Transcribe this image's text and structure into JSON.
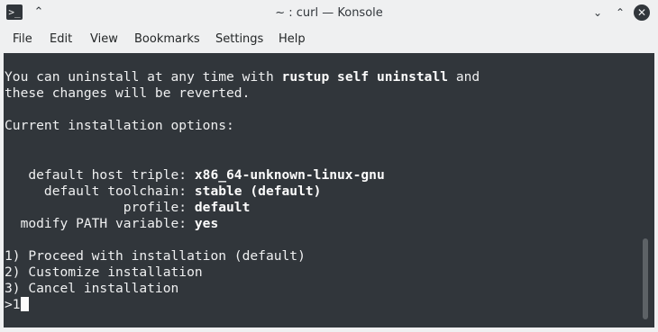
{
  "window": {
    "title": "~ : curl — Konsole"
  },
  "menu": [
    "File",
    "Edit",
    "View",
    "Bookmarks",
    "Settings",
    "Help"
  ],
  "terminal": {
    "lines": [
      {
        "segments": [
          {
            "t": "You can uninstall at any time with "
          },
          {
            "t": "rustup self uninstall",
            "b": true
          },
          {
            "t": " and"
          }
        ]
      },
      {
        "segments": [
          {
            "t": "these changes will be reverted."
          }
        ]
      },
      {
        "segments": [
          {
            "t": ""
          }
        ]
      },
      {
        "segments": [
          {
            "t": "Current installation options:"
          }
        ]
      },
      {
        "segments": [
          {
            "t": ""
          }
        ]
      },
      {
        "segments": [
          {
            "t": ""
          }
        ]
      },
      {
        "segments": [
          {
            "t": "   default host triple: "
          },
          {
            "t": "x86_64-unknown-linux-gnu",
            "b": true
          }
        ]
      },
      {
        "segments": [
          {
            "t": "     default toolchain: "
          },
          {
            "t": "stable (default)",
            "b": true
          }
        ]
      },
      {
        "segments": [
          {
            "t": "               profile: "
          },
          {
            "t": "default",
            "b": true
          }
        ]
      },
      {
        "segments": [
          {
            "t": "  modify PATH variable: "
          },
          {
            "t": "yes",
            "b": true
          }
        ]
      },
      {
        "segments": [
          {
            "t": ""
          }
        ]
      },
      {
        "segments": [
          {
            "t": "1) Proceed with installation (default)"
          }
        ]
      },
      {
        "segments": [
          {
            "t": "2) Customize installation"
          }
        ]
      },
      {
        "segments": [
          {
            "t": "3) Cancel installation"
          }
        ]
      }
    ],
    "prompt": ">1"
  },
  "icons": {
    "app": "konsole-icon",
    "keep_above": "keep-above-icon",
    "minimize": "chevron-down-icon",
    "maximize": "chevron-up-icon",
    "close": "close-icon"
  },
  "colors": {
    "titlebar_bg": "#eff0f1",
    "terminal_bg": "#31363b",
    "terminal_fg": "#eff0f1"
  }
}
